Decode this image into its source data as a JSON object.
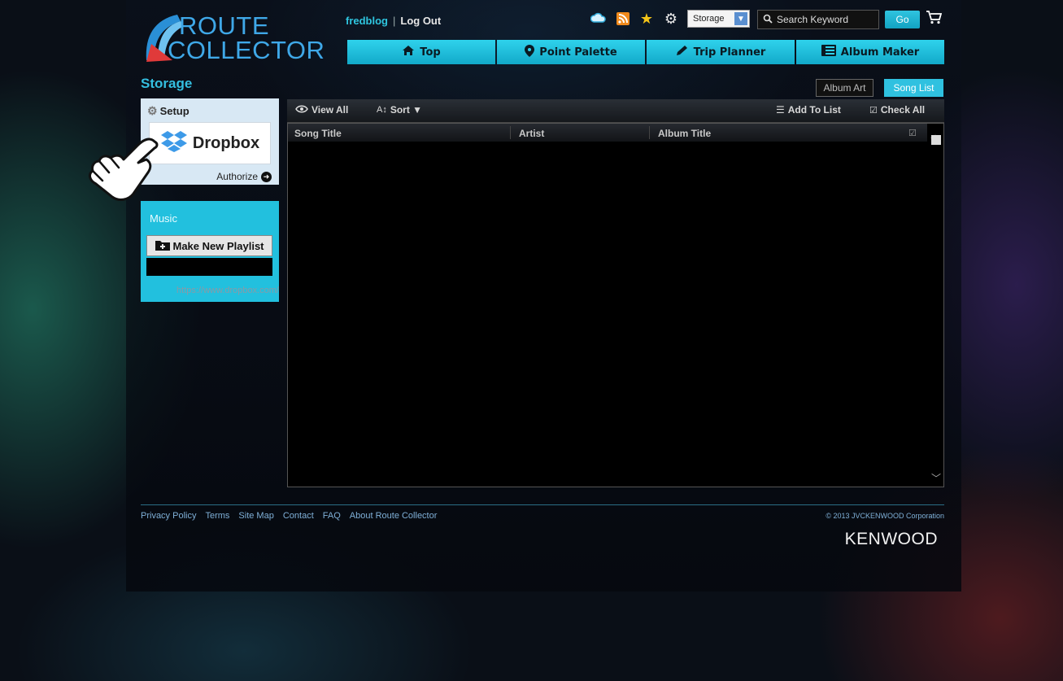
{
  "logo": {
    "line1": "ROUTE",
    "line2": "COLLECTOR"
  },
  "user": {
    "name": "fredblog",
    "logout_label": "Log Out"
  },
  "top_icons": [
    "cloud-icon",
    "rss-icon",
    "star-icon",
    "gear-icon"
  ],
  "storage_select": {
    "value": "Storage"
  },
  "search": {
    "placeholder": "Search Keyword",
    "go_label": "Go"
  },
  "nav": {
    "tabs": [
      {
        "label": "Top",
        "icon": "home-icon"
      },
      {
        "label": "Point Palette",
        "icon": "map-pin-icon"
      },
      {
        "label": "Trip Planner",
        "icon": "pencil-icon"
      },
      {
        "label": "Album Maker",
        "icon": "album-icon"
      }
    ]
  },
  "page": {
    "title": "Storage"
  },
  "view_tabs": {
    "album_art": "Album Art",
    "song_list": "Song List"
  },
  "setup": {
    "title": "Setup",
    "service_name": "Dropbox",
    "authorize_label": "Authorize",
    "url": "https://www.dropbox.com/"
  },
  "music": {
    "title": "Music",
    "make_playlist_label": "Make New Playlist"
  },
  "toolbar": {
    "view_all": "View All",
    "sort": "Sort ▼",
    "add_to_list": "Add To List",
    "check_all": "Check All"
  },
  "columns": {
    "song_title": "Song Title",
    "artist": "Artist",
    "album_title": "Album Title"
  },
  "footer": {
    "links": [
      "Privacy Policy",
      "Terms",
      "Site Map",
      "Contact",
      "FAQ",
      "About Route Collector"
    ],
    "copyright": "© 2013 JVCKENWOOD Corporation",
    "brand": "KENWOOD"
  },
  "colors": {
    "accent": "#22c0de",
    "nav_tab": "#2fd2ec",
    "setup_bg": "#d8e8f4",
    "background": "#0a0f17"
  }
}
